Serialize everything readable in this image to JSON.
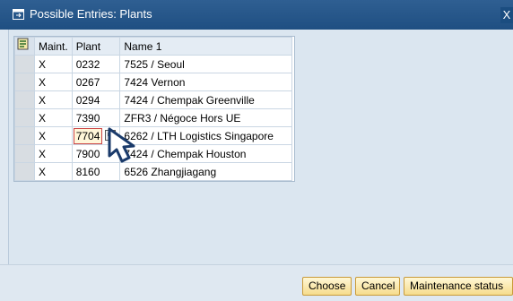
{
  "window": {
    "title": "Possible Entries: Plants",
    "close_symbol": "X"
  },
  "grid": {
    "columns": [
      "Maint.",
      "Plant",
      "Name 1"
    ],
    "rows": [
      {
        "maint": "X",
        "plant": "0232",
        "name": "7525 / Seoul"
      },
      {
        "maint": "X",
        "plant": "0267",
        "name": "7424 Vernon"
      },
      {
        "maint": "X",
        "plant": "0294",
        "name": "7424 / Chempak Greenville"
      },
      {
        "maint": "X",
        "plant": "7390",
        "name": "ZFR3 / Négoce Hors UE"
      },
      {
        "maint": "X",
        "plant": "7704",
        "name": "6262 / LTH Logistics Singapore"
      },
      {
        "maint": "X",
        "plant": "7900",
        "name": "7424 / Chempak Houston"
      },
      {
        "maint": "X",
        "plant": "8160",
        "name": "6526 Zhangjiagang"
      }
    ],
    "active_row_index": 4
  },
  "buttons": {
    "choose": "Choose",
    "cancel": "Cancel",
    "maintenance_status": "Maintenance status"
  },
  "icons": {
    "title": "dialog-icon",
    "grid_settings": "select-all-icon",
    "f4_help": "value-help-icon",
    "cursor": "mouse-pointer-icon"
  },
  "colors": {
    "titlebar": "#2f5f92",
    "button_fill": "#f6dc8c",
    "active_cell_border": "#cc4444"
  }
}
